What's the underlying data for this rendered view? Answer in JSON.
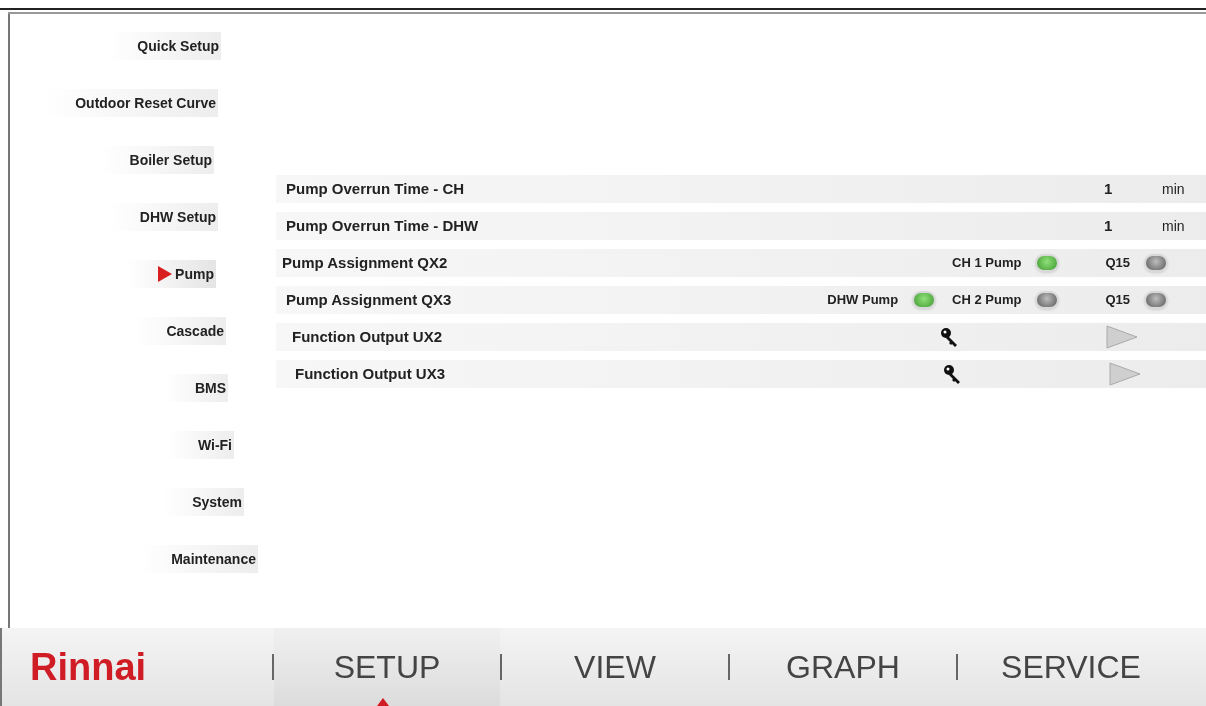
{
  "sidebar": {
    "items": [
      {
        "label": "Quick Setup",
        "selected": false
      },
      {
        "label": "Outdoor Reset Curve",
        "selected": false
      },
      {
        "label": "Boiler Setup",
        "selected": false
      },
      {
        "label": "DHW Setup",
        "selected": false
      },
      {
        "label": "Pump",
        "selected": true
      },
      {
        "label": "Cascade",
        "selected": false
      },
      {
        "label": "BMS",
        "selected": false
      },
      {
        "label": "Wi-Fi",
        "selected": false
      },
      {
        "label": "System",
        "selected": false
      },
      {
        "label": "Maintenance",
        "selected": false
      }
    ]
  },
  "settings": [
    {
      "kind": "value",
      "label": "Pump Overrun Time - CH",
      "value": "1",
      "unit": "min"
    },
    {
      "kind": "value",
      "label": "Pump Overrun Time - DHW",
      "value": "1",
      "unit": "min"
    },
    {
      "kind": "options",
      "label": "Pump Assignment QX2",
      "options": [
        {
          "label": "CH 1 Pump",
          "on": true
        },
        {
          "label": "Q15",
          "on": false
        }
      ]
    },
    {
      "kind": "options",
      "label": "Pump Assignment QX3",
      "options": [
        {
          "label": "DHW Pump",
          "on": true
        },
        {
          "label": "CH 2 Pump",
          "on": false
        },
        {
          "label": "Q15",
          "on": false
        }
      ]
    },
    {
      "kind": "action",
      "label": "Function Output UX2"
    },
    {
      "kind": "action",
      "label": "Function Output UX3"
    }
  ],
  "logo": "Rinnai",
  "tabs": [
    {
      "label": "SETUP",
      "selected": true
    },
    {
      "label": "VIEW",
      "selected": false
    },
    {
      "label": "GRAPH",
      "selected": false
    },
    {
      "label": "SERVICE",
      "selected": false
    }
  ]
}
